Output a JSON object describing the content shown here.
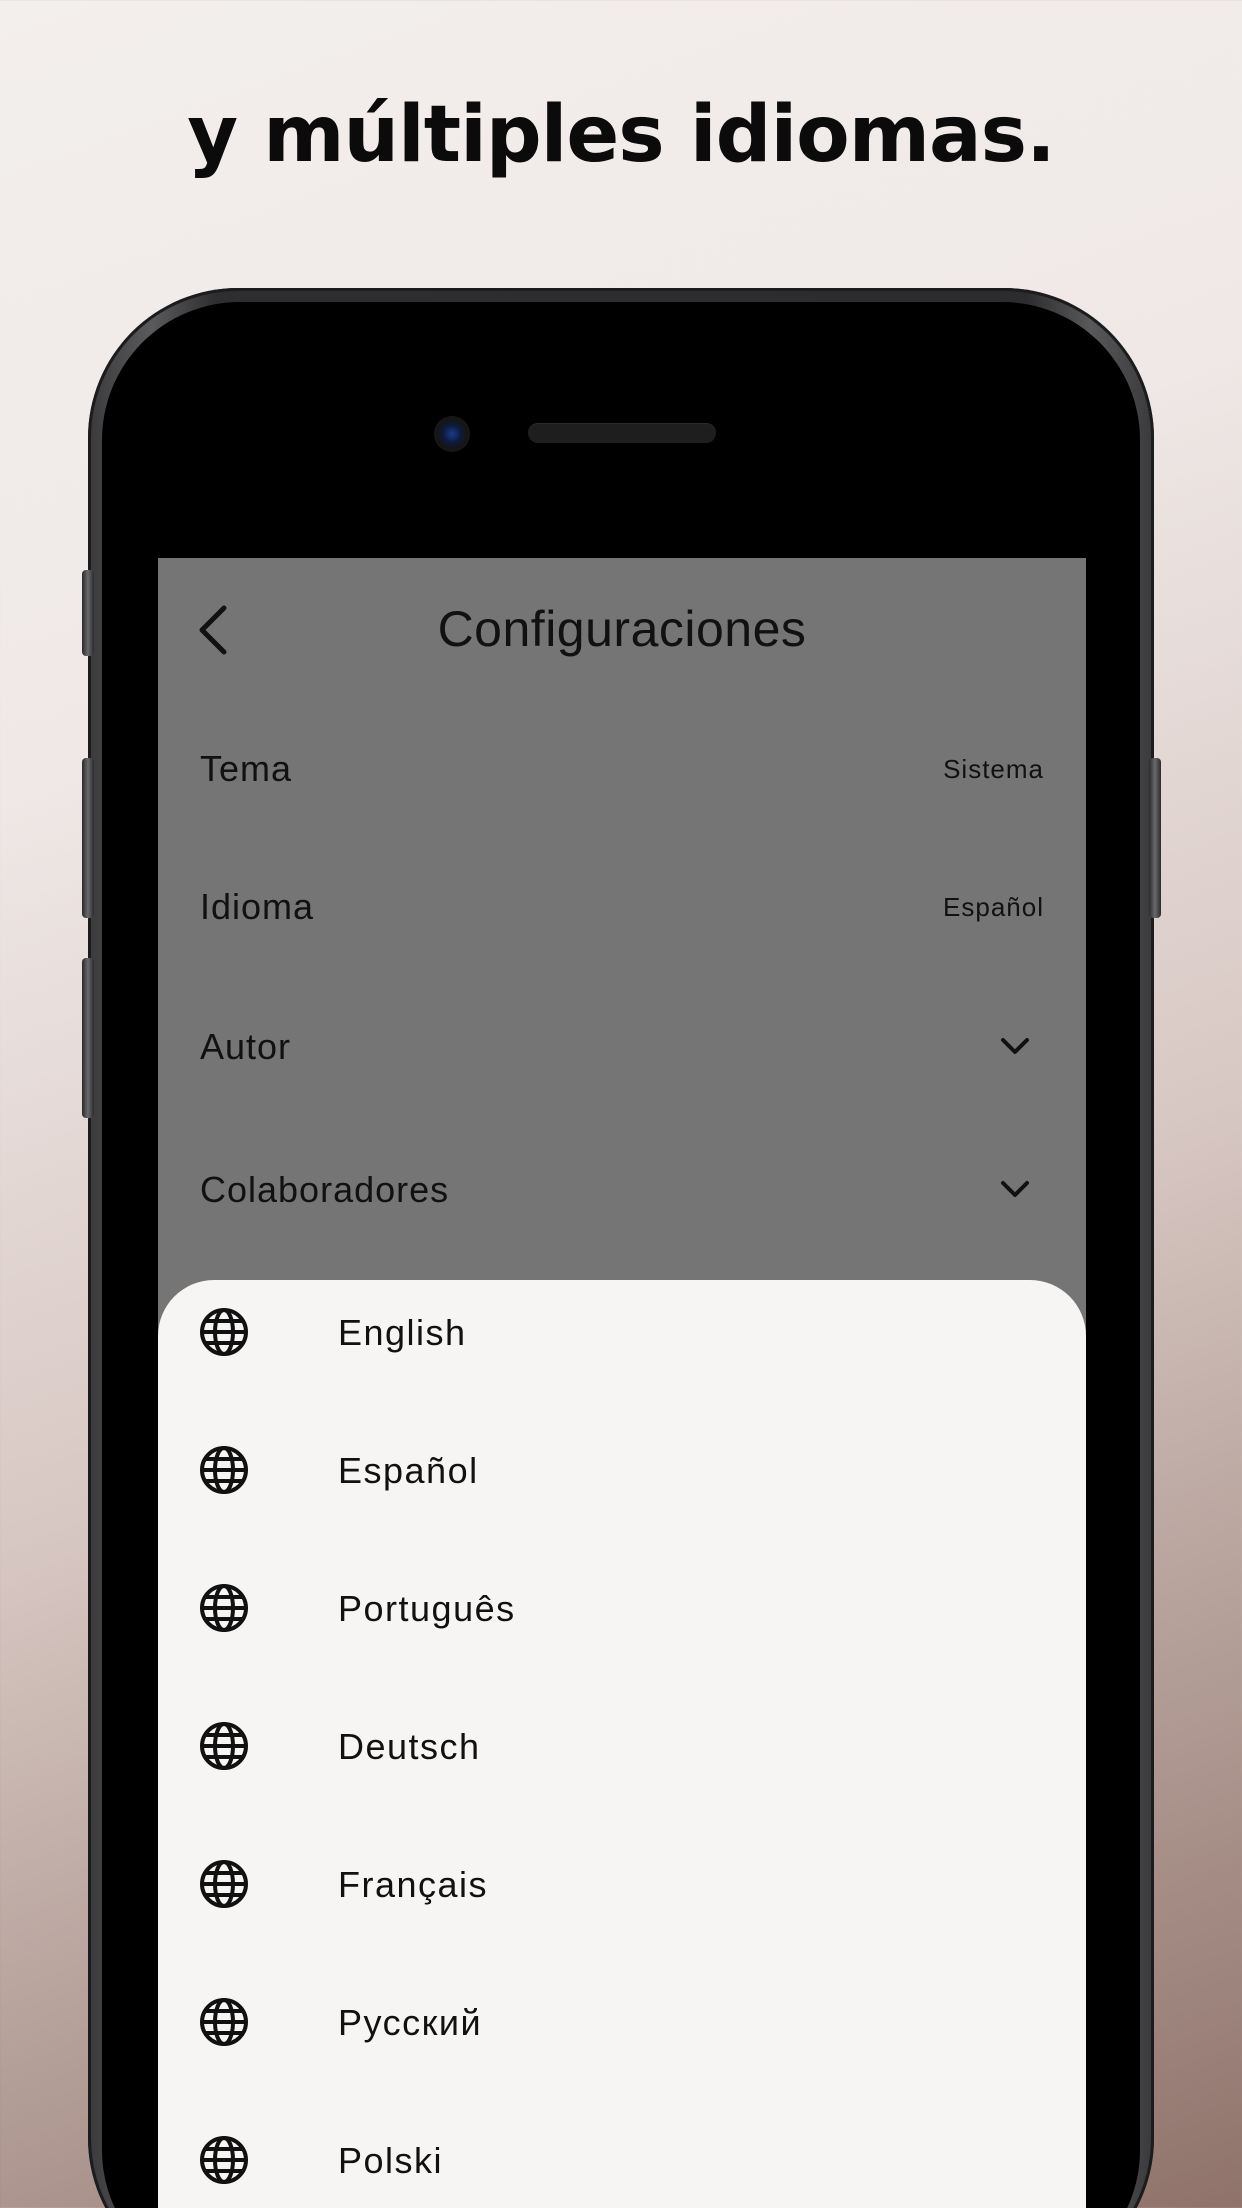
{
  "headline": "y múltiples idiomas.",
  "nav": {
    "title": "Configuraciones"
  },
  "settings": [
    {
      "label": "Tema",
      "value": "Sistema"
    },
    {
      "label": "Idioma",
      "value": "Español"
    },
    {
      "label": "Autor",
      "value": ""
    },
    {
      "label": "Colaboradores",
      "value": ""
    }
  ],
  "languages": [
    {
      "label": "English"
    },
    {
      "label": "Español"
    },
    {
      "label": "Português"
    },
    {
      "label": "Deutsch"
    },
    {
      "label": "Français"
    },
    {
      "label": "Русский"
    },
    {
      "label": "Polski"
    }
  ],
  "colors": {
    "overlay": "#757575",
    "sheet": "#f6f5f3",
    "text": "#111111"
  },
  "icons": {
    "back": "chevron-left-icon",
    "expand": "chevron-down-icon",
    "language": "globe-icon"
  }
}
